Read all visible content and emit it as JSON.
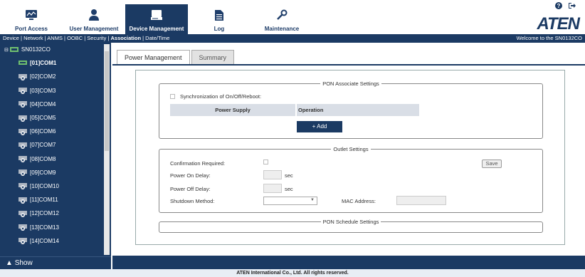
{
  "header": {
    "nav": [
      {
        "label": "Port Access",
        "icon": "monitor-icon"
      },
      {
        "label": "User Management",
        "icon": "user-icon"
      },
      {
        "label": "Device Management",
        "icon": "device-icon"
      },
      {
        "label": "Log",
        "icon": "document-icon"
      },
      {
        "label": "Maintenance",
        "icon": "wrench-icon"
      }
    ],
    "logo": "ATEN"
  },
  "subnav": {
    "items": [
      "Device",
      "Network",
      "ANMS",
      "OOBC",
      "Security",
      "Association",
      "Date/Time"
    ],
    "active": "Association",
    "welcome": "Welcome to the SN0132CO"
  },
  "sidebar": {
    "root": "SN0132CO",
    "ports": [
      "[01]COM1",
      "[02]COM2",
      "[03]COM3",
      "[04]COM4",
      "[05]COM5",
      "[06]COM6",
      "[07]COM7",
      "[08]COM8",
      "[09]COM9",
      "[10]COM10",
      "[11]COM11",
      "[12]COM12",
      "[13]COM13",
      "[14]COM14"
    ],
    "show_label": "Show"
  },
  "tabs": [
    {
      "label": "Power Management",
      "active": true
    },
    {
      "label": "Summary",
      "active": false
    }
  ],
  "pon_associate": {
    "legend": "PON Associate Settings",
    "sync_label": "Synchronization of On/Off/Reboot:",
    "col_power_supply": "Power Supply",
    "col_operation": "Operation",
    "add_label": "+ Add"
  },
  "outlet": {
    "legend": "Outlet Settings",
    "confirmation_label": "Confirmation Required:",
    "save_label": "Save",
    "on_delay_label": "Power On Delay:",
    "off_delay_label": "Power Off Delay:",
    "unit": "sec",
    "shutdown_label": "Shutdown Method:",
    "mac_label": "MAC Address:"
  },
  "pon_schedule": {
    "legend": "PON Schedule Settings"
  },
  "footer": "ATEN International Co., Ltd. All rights reserved.",
  "colors": {
    "brand": "#1b3a63",
    "sidebar": "#1b3a63",
    "green_port": "#5cb85c"
  }
}
